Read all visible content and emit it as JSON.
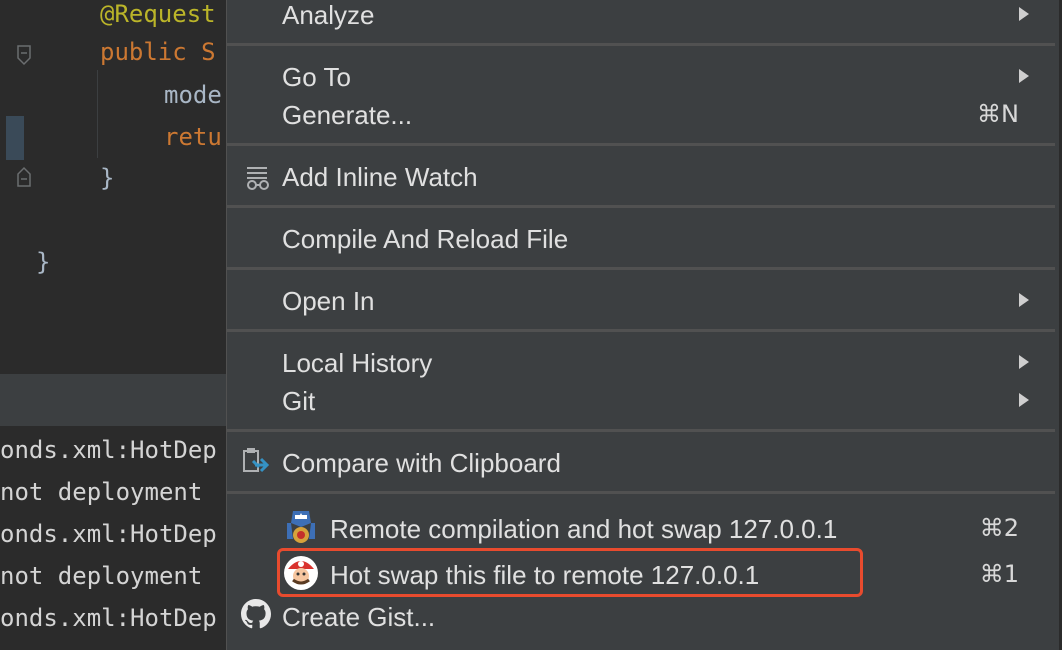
{
  "editor": {
    "lines": [
      {
        "text": "@Request",
        "style": "ann"
      },
      {
        "text": "public S",
        "style": "kw"
      },
      {
        "text": "mode",
        "style": "plain"
      },
      {
        "text": "retu",
        "style": "kw"
      },
      {
        "text": "}",
        "style": "plain"
      },
      {
        "text": "}",
        "style": "plain"
      }
    ]
  },
  "console": {
    "lines": [
      "onds.xml:HotDep",
      "not deployment ",
      "onds.xml:HotDep",
      "not deployment ",
      "onds.xml:HotDep"
    ]
  },
  "menu": {
    "analyze": "Analyze",
    "go_to": "Go To",
    "generate": "Generate...",
    "generate_shortcut": "⌘N",
    "add_inline_watch": "Add Inline Watch",
    "compile_reload": "Compile And Reload File",
    "open_in": "Open In",
    "local_history": "Local History",
    "git": "Git",
    "compare_clipboard": "Compare with Clipboard",
    "remote_compile": "Remote compilation and hot swap 127.0.0.1",
    "remote_compile_shortcut": "⌘2",
    "hot_swap": "Hot swap this file to remote 127.0.0.1",
    "hot_swap_shortcut": "⌘1",
    "create_gist": "Create Gist..."
  },
  "colors": {
    "menu_bg": "#3c3f41",
    "highlight": "#e84b2e",
    "editor_bg": "#2b2b2b"
  }
}
